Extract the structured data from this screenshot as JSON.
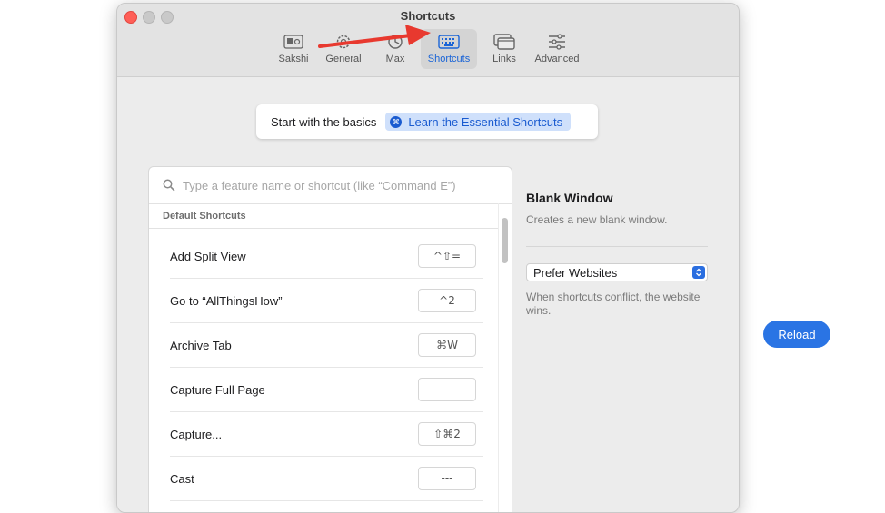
{
  "window": {
    "title": "Shortcuts",
    "toolbar": [
      {
        "label": "Sakshi",
        "icon": "profile-card-icon"
      },
      {
        "label": "General",
        "icon": "gear-icon"
      },
      {
        "label": "Max",
        "icon": "max-icon"
      },
      {
        "label": "Shortcuts",
        "icon": "keyboard-icon",
        "active": true
      },
      {
        "label": "Links",
        "icon": "links-window-icon"
      },
      {
        "label": "Advanced",
        "icon": "sliders-icon"
      }
    ]
  },
  "basics": {
    "text": "Start with the basics",
    "learn_label": "Learn the Essential Shortcuts",
    "learn_icon": "⌘"
  },
  "search": {
    "placeholder": "Type a feature name or shortcut (like “Command E”)"
  },
  "section_header": "Default Shortcuts",
  "shortcuts": [
    {
      "name": "Add Split View",
      "key": "^⇧="
    },
    {
      "name": "Go to “AllThingsHow”",
      "key": "^2"
    },
    {
      "name": "Archive Tab",
      "key": "⌘W"
    },
    {
      "name": "Capture Full Page",
      "key": "---"
    },
    {
      "name": "Capture...",
      "key": "⇧⌘2"
    },
    {
      "name": "Cast",
      "key": "---"
    }
  ],
  "detail": {
    "title": "Blank Window",
    "description": "Creates a new blank window.",
    "select_value": "Prefer Websites",
    "note": "When shortcuts conflict, the website wins."
  },
  "reload_label": "Reload",
  "colors": {
    "accent": "#2a74e4",
    "arrow": "#e8392f",
    "close": "#ff5f57"
  }
}
